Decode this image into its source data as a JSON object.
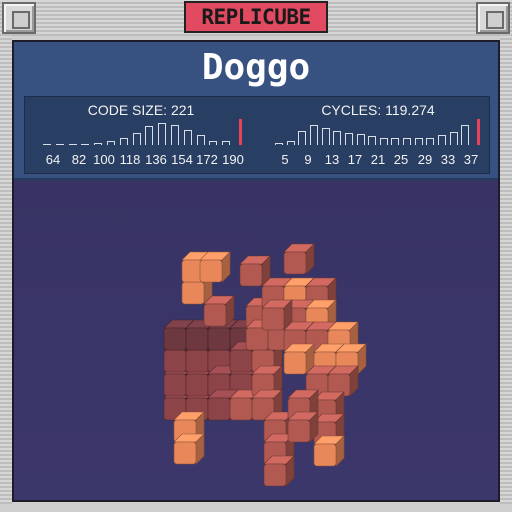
{
  "window": {
    "title": "REPLICUBE",
    "accent_color": "#e24a62"
  },
  "puzzle": {
    "name": "Doggo"
  },
  "stats": {
    "code_size": {
      "label": "CODE SIZE: 221",
      "ticks": [
        "64",
        "82",
        "100",
        "118",
        "136",
        "154",
        "172",
        "190"
      ],
      "bars": [
        0,
        0,
        0,
        0,
        0.1,
        0.2,
        0.3,
        0.55,
        0.85,
        1.0,
        0.9,
        0.7,
        0.45,
        0.2,
        0.2
      ],
      "marker_color": "#e8435b"
    },
    "cycles": {
      "label": "CYCLES: 119.274",
      "ticks": [
        "5",
        "9",
        "13",
        "17",
        "21",
        "25",
        "29",
        "33",
        "37"
      ],
      "bars": [
        0.1,
        0.2,
        0.65,
        0.9,
        0.75,
        0.65,
        0.55,
        0.5,
        0.4,
        0.3,
        0.3,
        0.3,
        0.3,
        0.3,
        0.45,
        0.6,
        0.9
      ],
      "marker_color": "#e8435b"
    }
  },
  "scene": {
    "subject": "voxel dog built from cubes",
    "background_color": "#3a3568",
    "cube_colors": [
      "#e8875a",
      "#b25a52",
      "#8c4448",
      "#6e3840"
    ]
  }
}
